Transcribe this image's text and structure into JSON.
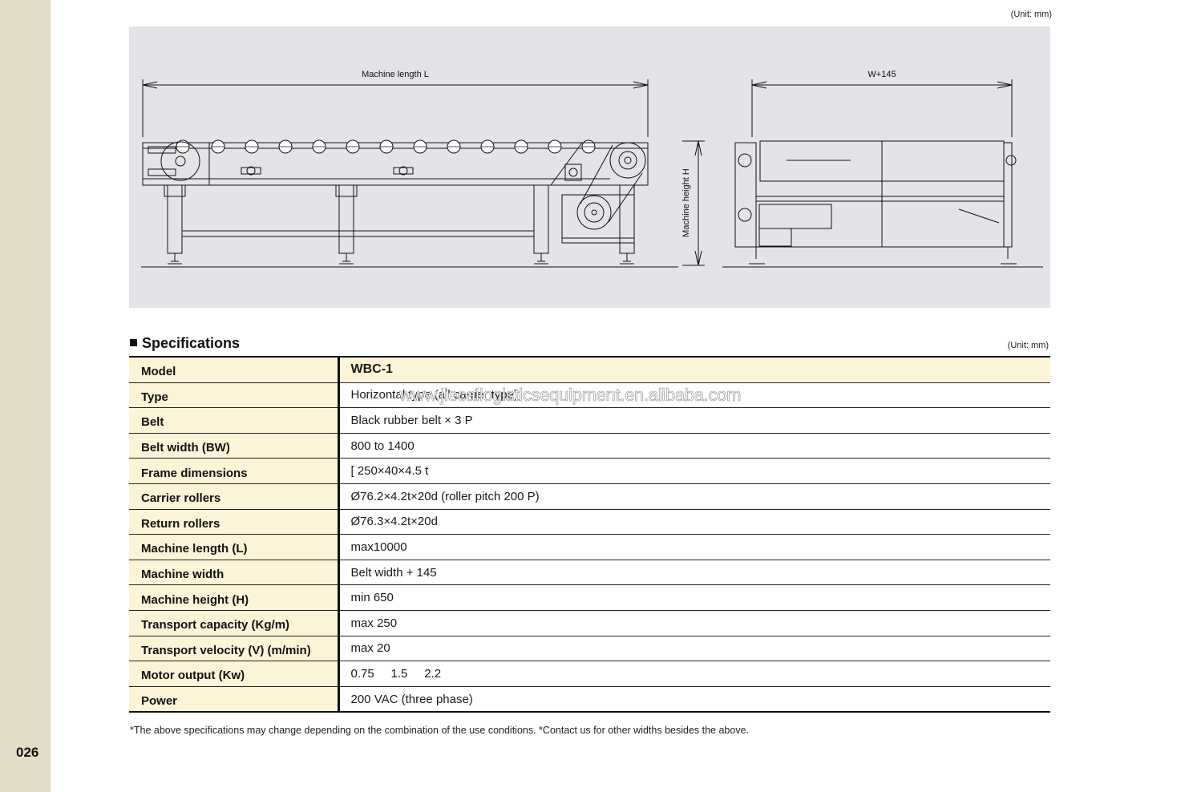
{
  "page": {
    "number": "026",
    "unit_top": "(Unit: mm)",
    "unit_spec": "(Unit: mm)"
  },
  "drawing": {
    "machine_length_label": "Machine length L",
    "width_label": "W+145",
    "height_label": "Machine height H"
  },
  "specifications": {
    "title": "Specifications",
    "rows": [
      {
        "label": "Model",
        "value": "WBC-1"
      },
      {
        "label": "Type",
        "value": "Horizontal type (all carrier type)"
      },
      {
        "label": "Belt",
        "value": "Black rubber belt × 3 P"
      },
      {
        "label": "Belt width (BW)",
        "value": "800 to 1400"
      },
      {
        "label": "Frame dimensions",
        "value": "[ 250×40×4.5 t"
      },
      {
        "label": "Carrier rollers",
        "value": "Ø76.2×4.2t×20d  (roller pitch 200 P)"
      },
      {
        "label": "Return rollers",
        "value": "Ø76.3×4.2t×20d"
      },
      {
        "label": "Machine length (L)",
        "value": "max10000"
      },
      {
        "label": "Machine width",
        "value": "Belt width + 145"
      },
      {
        "label": "Machine height (H)",
        "value": "min 650"
      },
      {
        "label": "Transport capacity (Kg/m)",
        "value": "max 250"
      },
      {
        "label": "Transport velocity (V) (m/min)",
        "value": "max 20"
      },
      {
        "label": "Motor output (Kw)",
        "value": "0.75     1.5     2.2"
      },
      {
        "label": "Power",
        "value": "200 VAC (three phase)"
      }
    ]
  },
  "watermark": "www.jiecailogisticsequipment.en.alibaba.com",
  "footnote": "*The above specifications may change depending on the combination of the use conditions.  *Contact us for other widths besides the above."
}
